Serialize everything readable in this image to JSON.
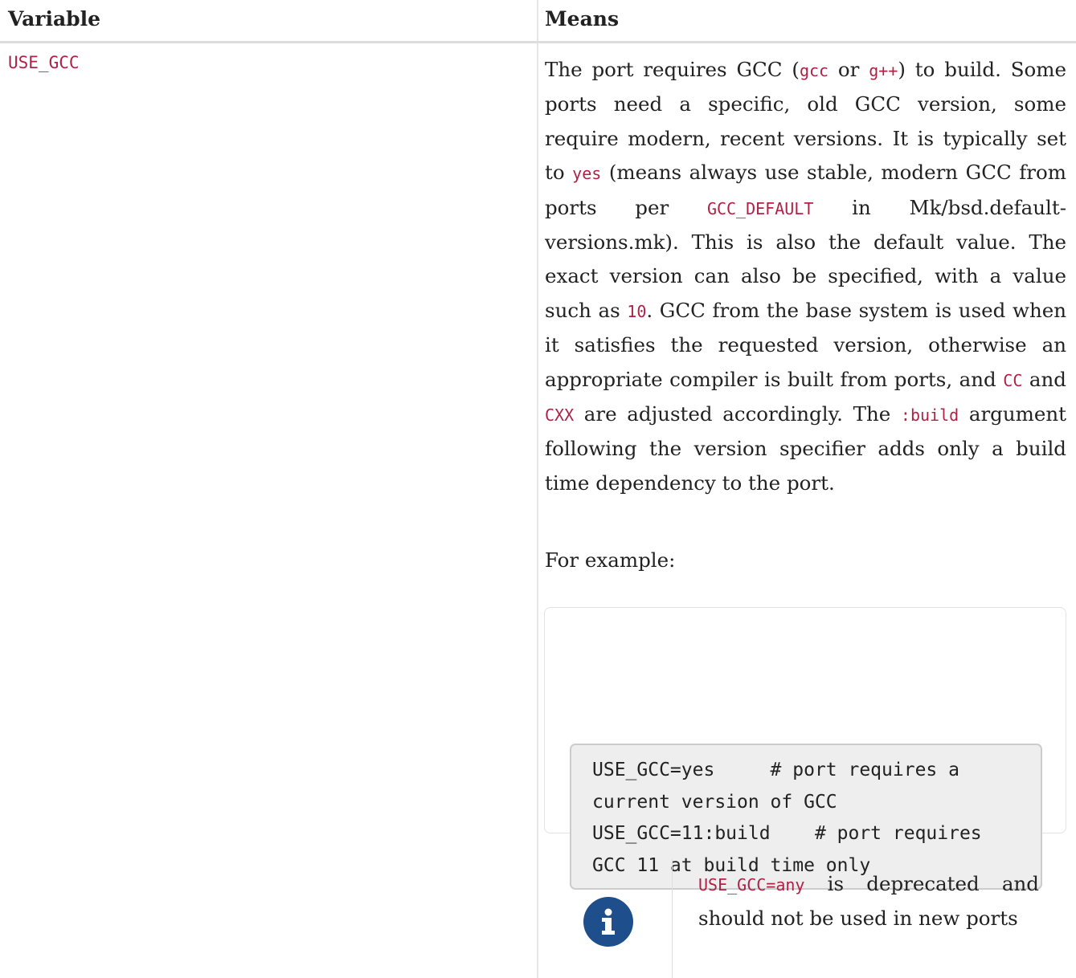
{
  "table": {
    "headers": {
      "variable": "Variable",
      "means": "Means"
    },
    "row": {
      "variable": "USE_GCC",
      "description": [
        {
          "t": "text",
          "v": "The port requires GCC ("
        },
        {
          "t": "code",
          "v": "gcc"
        },
        {
          "t": "text",
          "v": " or "
        },
        {
          "t": "code",
          "v": "g++"
        },
        {
          "t": "text",
          "v": ") to build. Some ports need a specific, old GCC version, some require modern, recent versions. It is typically set to "
        },
        {
          "t": "code",
          "v": "yes"
        },
        {
          "t": "text",
          "v": " (means always use stable, modern GCC from ports per "
        },
        {
          "t": "code",
          "v": "GCC_DEFAULT"
        },
        {
          "t": "text",
          "v": " in Mk/bsd.default-versions.mk). This is also the default value. The exact version can also be specified, with a value such as "
        },
        {
          "t": "code",
          "v": "10"
        },
        {
          "t": "text",
          "v": ". GCC from the base system is used when it satisfies the requested version, otherwise an appropriate compiler is built from ports, and "
        },
        {
          "t": "code",
          "v": "CC"
        },
        {
          "t": "text",
          "v": " and "
        },
        {
          "t": "code",
          "v": "CXX"
        },
        {
          "t": "text",
          "v": " are adjusted accordingly. The "
        },
        {
          "t": "code",
          "v": ":build"
        },
        {
          "t": "text",
          "v": " argument following the version specifier adds only a build time dependency to the port."
        }
      ],
      "example_label": "For example:",
      "example_code": [
        "USE_GCC=yes     # port requires a",
        "current version of GCC",
        "USE_GCC=11:build    # port requires",
        "GCC 11 at build time only"
      ],
      "note": {
        "icon": "info-icon",
        "parts": [
          {
            "t": "code",
            "v": "USE_GCC=any"
          },
          {
            "t": "text",
            "v": " is deprecated and should not be used in new ports"
          }
        ]
      }
    }
  },
  "colors": {
    "code_text": "#b12146",
    "info_icon_bg": "#1f4e8c",
    "code_block_bg": "#eeeeee"
  }
}
